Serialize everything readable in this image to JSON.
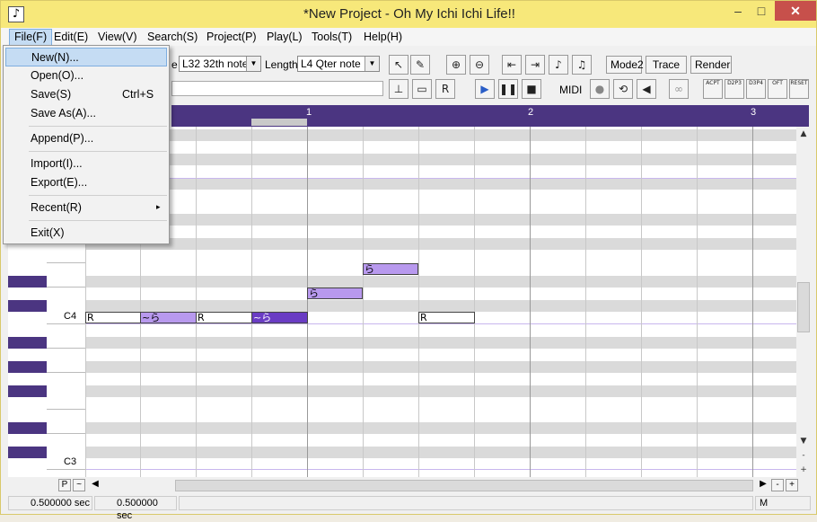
{
  "window": {
    "title": "*New Project - Oh My Ichi Ichi Life!!",
    "controls": {
      "minimize": "–",
      "maximize": "□",
      "close": "✕"
    }
  },
  "menubar": [
    "File(F)",
    "Edit(E)",
    "View(V)",
    "Search(S)",
    "Project(P)",
    "Play(L)",
    "Tools(T)",
    "Help(H)"
  ],
  "file_menu": {
    "items": [
      {
        "label": "New(N)...",
        "shortcut": "",
        "highlighted": true
      },
      {
        "label": "Open(O)...",
        "shortcut": ""
      },
      {
        "label": "Save(S)",
        "shortcut": "Ctrl+S"
      },
      {
        "label": "Save As(A)...",
        "shortcut": ""
      },
      {
        "label": "Append(P)...",
        "shortcut": ""
      },
      {
        "label": "Import(I)...",
        "shortcut": ""
      },
      {
        "label": "Export(E)...",
        "shortcut": ""
      },
      {
        "label": "Recent(R)",
        "shortcut": "",
        "submenu_arrow": "▸"
      },
      {
        "label": "Exit(X)",
        "shortcut": ""
      }
    ]
  },
  "toolbar": {
    "quantize_label_fragment": "e",
    "quantize_value": "L32  32th note",
    "length_label": "Length",
    "length_value": "L4   Qter note",
    "mode_button": "Mode2",
    "trace_button": "Trace",
    "render_button": "Render",
    "midi_label": "MIDI",
    "curve_buttons": [
      "ACPT",
      "D2P3",
      "D3P4",
      "OFT",
      "RESET"
    ]
  },
  "ruler": {
    "measures": [
      "1",
      "2",
      "3"
    ]
  },
  "piano": {
    "labels": [
      "C4",
      "C3"
    ]
  },
  "notes": [
    {
      "lyric": "R",
      "kind": "rest"
    },
    {
      "lyric": "~ら",
      "kind": "voice"
    },
    {
      "lyric": "R",
      "kind": "rest"
    },
    {
      "lyric": "~ら",
      "kind": "selected"
    },
    {
      "lyric": "ら",
      "kind": "voice"
    },
    {
      "lyric": "ら",
      "kind": "voice"
    },
    {
      "lyric": "R",
      "kind": "rest"
    }
  ],
  "bottom": {
    "p_button": "P",
    "tilde_button": "~",
    "minus_button": "-",
    "plus_button": "+"
  },
  "status": {
    "time_left": "0.500000 sec",
    "time_right": "0.500000 sec",
    "mode_indicator": "M"
  },
  "colors": {
    "titlebar": "#f7e87a",
    "ruler": "#4b3581",
    "voice_note": "#b899ee",
    "selected_note": "#6a3cc4"
  }
}
